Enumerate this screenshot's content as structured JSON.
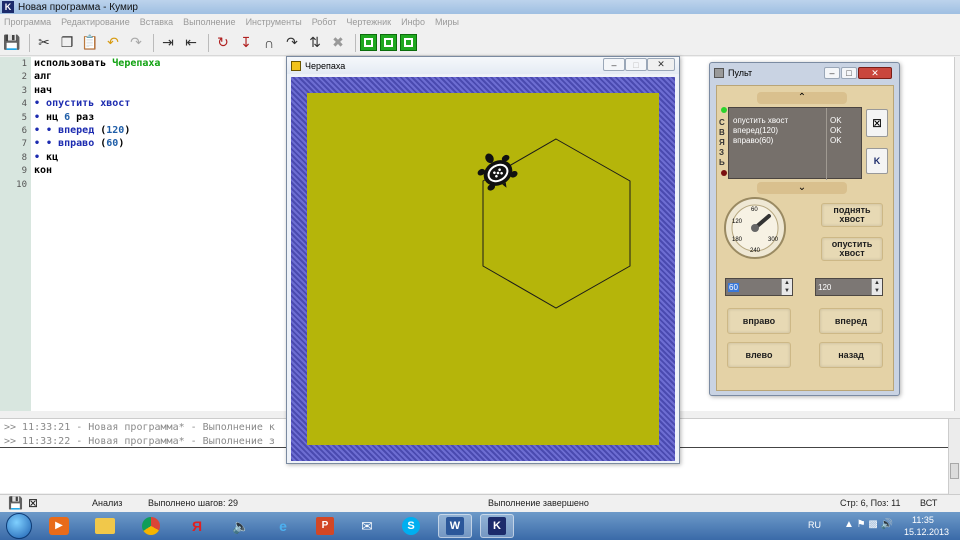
{
  "app": {
    "title": "Новая программа - Кумир",
    "icon_letter": "K"
  },
  "menu": [
    "Программа",
    "Редактирование",
    "Вставка",
    "Выполнение",
    "Инструменты",
    "Робот",
    "Чертежник",
    "Инфо",
    "Миры"
  ],
  "toolbar": {
    "icons": [
      "save-icon",
      "cut-icon",
      "copy-icon",
      "paste-icon",
      "undo-icon",
      "redo-icon",
      "indent-icon",
      "outdent-icon",
      "run-icon",
      "step-icon",
      "step-in-icon",
      "step-out-icon",
      "stop-icon",
      "window-grid-icon",
      "window-frame-icon",
      "window-cross-icon"
    ]
  },
  "editor": {
    "lines": [
      {
        "n": "1",
        "parts": [
          {
            "t": "использовать ",
            "c": "kw"
          },
          {
            "t": "Черепаха",
            "c": "mod"
          }
        ]
      },
      {
        "n": "2",
        "parts": [
          {
            "t": "алг",
            "c": "kw"
          }
        ]
      },
      {
        "n": "3",
        "parts": [
          {
            "t": "нач",
            "c": "kw"
          }
        ]
      },
      {
        "n": "4",
        "parts": [
          {
            "t": "• ",
            "c": "dot"
          },
          {
            "t": "опустить хвост",
            "c": "blue"
          }
        ]
      },
      {
        "n": "5",
        "parts": [
          {
            "t": "• ",
            "c": "dot"
          },
          {
            "t": "нц ",
            "c": "kw"
          },
          {
            "t": "6",
            "c": "num"
          },
          {
            "t": " раз",
            "c": "kw"
          }
        ]
      },
      {
        "n": "6",
        "parts": [
          {
            "t": "• • ",
            "c": "dot"
          },
          {
            "t": "вперед",
            "c": "blue"
          },
          {
            "t": " (",
            "c": "kw"
          },
          {
            "t": "120",
            "c": "num"
          },
          {
            "t": ")",
            "c": "kw"
          }
        ]
      },
      {
        "n": "7",
        "parts": [
          {
            "t": "• • ",
            "c": "dot"
          },
          {
            "t": "вправо",
            "c": "blue"
          },
          {
            "t": " (",
            "c": "kw"
          },
          {
            "t": "60",
            "c": "num"
          },
          {
            "t": ")",
            "c": "kw"
          }
        ]
      },
      {
        "n": "8",
        "parts": [
          {
            "t": "• ",
            "c": "dot"
          },
          {
            "t": "кц",
            "c": "kw"
          }
        ]
      },
      {
        "n": "9",
        "parts": [
          {
            "t": "кон",
            "c": "kw"
          }
        ]
      },
      {
        "n": "10",
        "parts": []
      }
    ]
  },
  "console": {
    "lines": [
      ">> 11:33:21 - Новая программа* - Выполнение к",
      ">> 11:33:22 - Новая программа* - Выполнение з"
    ]
  },
  "statusbar": {
    "mode": "Анализ",
    "steps": "Выполнено шагов: 29",
    "message": "Выполнение завершено",
    "position": "Стр: 6, Поз: 11",
    "insert_mode": "ВСТ"
  },
  "turtle_window": {
    "title": "Черепаха"
  },
  "pult": {
    "title": "Пульт",
    "link_label": [
      "С",
      "В",
      "Я",
      "З",
      "Ь"
    ],
    "log": [
      {
        "cmd": "опустить хвост",
        "status": "OK"
      },
      {
        "cmd": "вперед(120)",
        "status": "OK"
      },
      {
        "cmd": "вправо(60)",
        "status": "OK"
      }
    ],
    "btn_tail_up": "поднять хвост",
    "btn_tail_down": "опустить хвост",
    "angle_value": "60",
    "distance_value": "120",
    "btn_right": "вправо",
    "btn_forward": "вперед",
    "btn_left": "влево",
    "btn_back": "назад",
    "dial_labels": [
      "60",
      "120",
      "180",
      "240",
      "300"
    ],
    "side_btn_k": "K",
    "side_btn_clear": "⊠"
  },
  "taskbar": {
    "lang": "RU",
    "time": "11:35",
    "date": "15.12.2013",
    "apps": [
      "media-player-icon",
      "folder-icon",
      "chrome-icon",
      "yandex-icon",
      "volume-icon",
      "ie-icon",
      "powerpoint-icon",
      "mail-icon",
      "skype-icon",
      "word-icon",
      "kumir-icon"
    ]
  },
  "colors": {
    "field": "#b5b50a",
    "border": "#5555c0",
    "pult_body": "#e4d2a6"
  }
}
